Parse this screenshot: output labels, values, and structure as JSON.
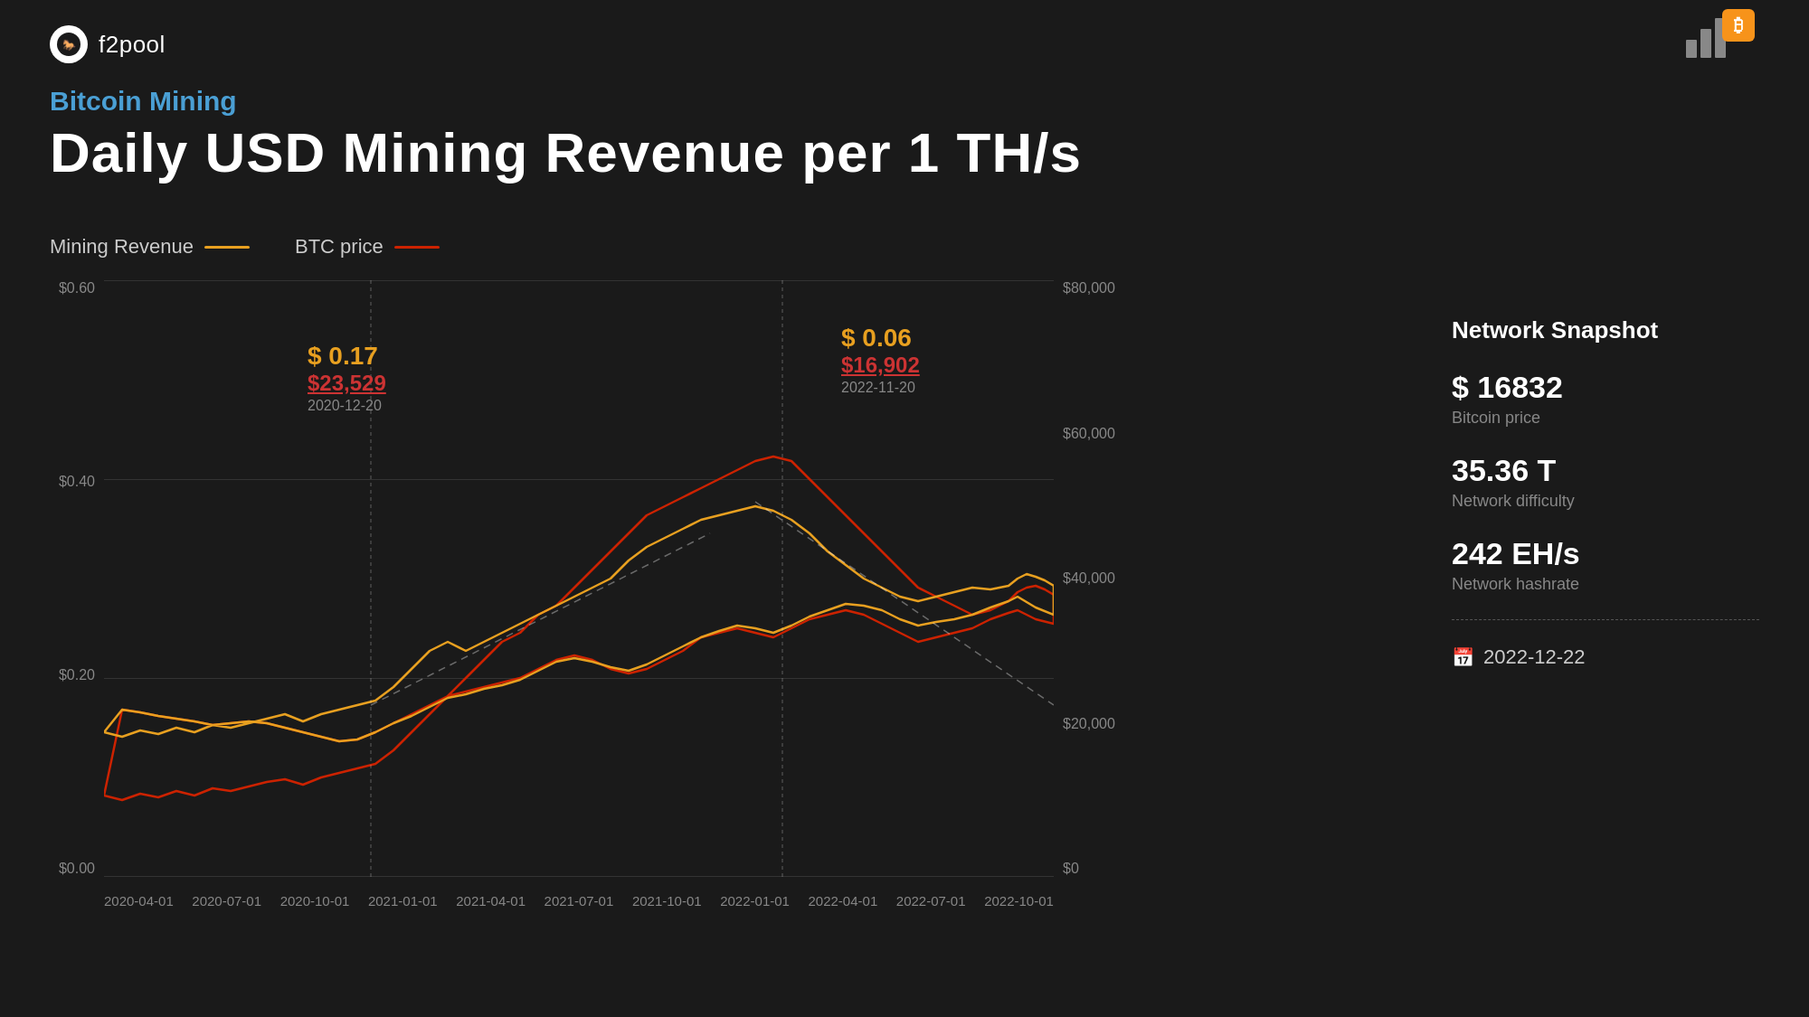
{
  "brand": {
    "logo_text": "f2pool",
    "name": "f2pool"
  },
  "title": {
    "subtitle": "Bitcoin Mining",
    "main": "Daily USD Mining Revenue per 1 TH/s"
  },
  "legend": {
    "mining_revenue_label": "Mining Revenue",
    "btc_price_label": "BTC price"
  },
  "chart": {
    "y_axis_left": [
      "$0.60",
      "$0.40",
      "$0.20",
      "$0.00"
    ],
    "y_axis_right": [
      "$80,000",
      "$60,000",
      "$40,000",
      "$20,000",
      "$0"
    ],
    "x_axis": [
      "2020-04-01",
      "2020-07-01",
      "2020-10-01",
      "2021-01-01",
      "2021-04-01",
      "2021-07-01",
      "2021-10-01",
      "2022-01-01",
      "2022-04-01",
      "2022-07-01",
      "2022-10-01"
    ]
  },
  "tooltip_left": {
    "value": "$ 0.17",
    "btc": "$23,529",
    "date": "2020-12-20"
  },
  "tooltip_right": {
    "value": "$ 0.06",
    "btc": "$16,902",
    "date": "2022-11-20"
  },
  "network": {
    "title": "Network Snapshot",
    "btc_price_label": "$ 16832",
    "btc_price_desc": "Bitcoin price",
    "difficulty_label": "35.36 T",
    "difficulty_desc": "Network difficulty",
    "hashrate_label": "242 EH/s",
    "hashrate_desc": "Network hashrate",
    "date": "2022-12-22"
  }
}
